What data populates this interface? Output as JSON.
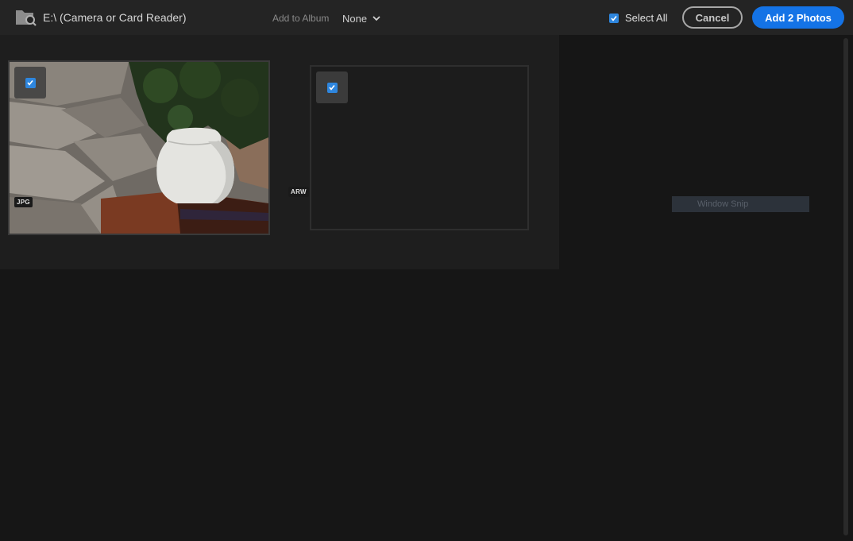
{
  "header": {
    "source_label": "E:\\ (Camera or Card Reader)",
    "album_label": "Add to Album",
    "album_value": "None",
    "select_all_label": "Select All",
    "cancel_label": "Cancel",
    "add_label": "Add 2 Photos"
  },
  "photos": [
    {
      "format": "JPG",
      "selected": true
    },
    {
      "format": "ARW",
      "selected": true
    }
  ],
  "overlay": {
    "snip_label": "Window Snip"
  },
  "colors": {
    "accent": "#1473e6",
    "checkbox": "#2e86de",
    "background": "#161616"
  }
}
